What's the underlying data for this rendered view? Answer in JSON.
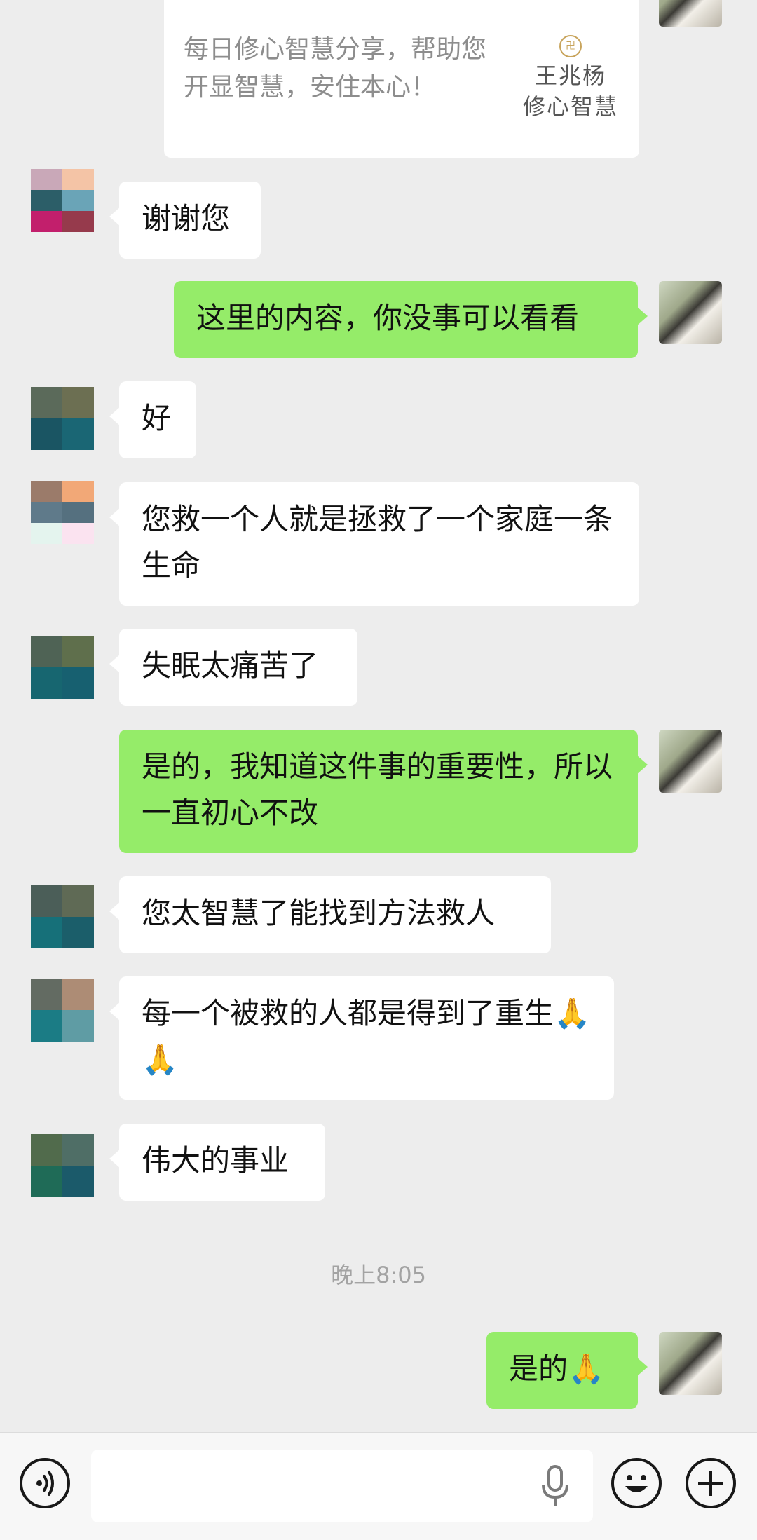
{
  "shared_card": {
    "text": "每日修心智慧分享，帮助您开显智慧，安住本心！",
    "logo_seal": "王兆杨",
    "logo_line1": "王兆杨",
    "logo_line2": "修心智慧"
  },
  "messages": [
    {
      "side": "in",
      "text": "谢谢您"
    },
    {
      "side": "out",
      "text": "这里的内容，你没事可以看看"
    },
    {
      "side": "in",
      "text": "好"
    },
    {
      "side": "in",
      "text": "您救一个人就是拯救了一个家庭一条生命"
    },
    {
      "side": "in",
      "text": "失眠太痛苦了"
    },
    {
      "side": "out",
      "text": "是的，我知道这件事的重要性，所以一直初心不改"
    },
    {
      "side": "in",
      "text": "您太智慧了能找到方法救人"
    },
    {
      "side": "in",
      "text": "每一个被救的人都是得到了重生🙏🙏"
    },
    {
      "side": "in",
      "text": "伟大的事业"
    },
    {
      "side": "out",
      "text": "是的🙏"
    }
  ],
  "timestamp": "晚上8:05",
  "input_bar": {
    "voice_icon": "voice-input-icon",
    "mic_icon": "microphone-icon",
    "emoji_icon": "emoji-icon",
    "plus_icon": "plus-icon",
    "input_value": ""
  },
  "colors": {
    "background": "#ededed",
    "incoming_bubble": "#ffffff",
    "outgoing_bubble": "#95ec69"
  }
}
